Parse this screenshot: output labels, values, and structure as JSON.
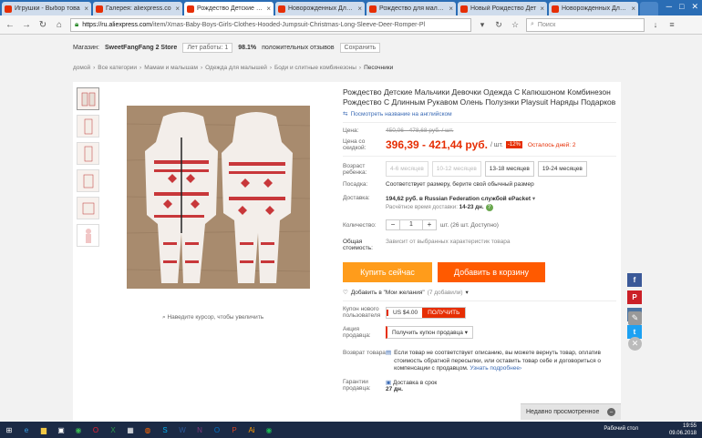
{
  "browser": {
    "tabs": [
      {
        "label": "Игрушки - Выбор това",
        "favicon_color": "#e62e04",
        "active": false
      },
      {
        "label": "Галерея: aliexpress.co",
        "favicon_color": "#e62e04",
        "active": false
      },
      {
        "label": "Рождество Детские Ма",
        "favicon_color": "#e62e04",
        "active": true
      },
      {
        "label": "Новорожденных Для м",
        "favicon_color": "#e62e04",
        "active": false
      },
      {
        "label": "Рождество для мальчи",
        "favicon_color": "#e62e04",
        "active": false
      },
      {
        "label": "Новый Рождество Дет",
        "favicon_color": "#e62e04",
        "active": false
      },
      {
        "label": "Новорожденных Для м",
        "favicon_color": "#e62e04",
        "active": false
      }
    ],
    "url_host": "https://ru.aliexpress.com",
    "url_path": "/item/Xmas-Baby-Boys-Girls-Clothes-Hooded-Jumpsuit-Christmas-Long-Sleeve-Deer-Romper-Pl",
    "search_placeholder": "Поиск"
  },
  "store": {
    "label": "Магазин:",
    "name": "SweetFangFang 2 Store",
    "years": "Лет работы: 1",
    "rating_pct": "98.1%",
    "rating_text": "положительных отзывов",
    "save": "Сохранить"
  },
  "breadcrumbs": [
    "домой",
    "Все категории",
    "Мамам и малышам",
    "Одежда для малышей",
    "Боди и слитные комбинезоны",
    "Песочники"
  ],
  "product": {
    "title": "Рождество Детские Мальчики Девочки Одежда С Капюшоном Комбинезон Рождество С Длинным Рукавом Олень Полузнки Playsuit Наряды Подарков",
    "translate": "Посмотреть название на английском",
    "price_label": "Цена:",
    "price_old": "450,06 - 478,68 руб. / шт.",
    "discount_label": "Цена со скидкой:",
    "price_new": "396,39 - 421,44 руб.",
    "price_unit": "/ шт.",
    "discount_pct": "-12%",
    "days_left": "Осталось дней: 2",
    "age_label": "Возраст ребенка:",
    "sizes": [
      {
        "label": "4-6 месяцев",
        "available": false
      },
      {
        "label": "10-12 месяцев",
        "available": false
      },
      {
        "label": "13-18 месяцев",
        "available": true
      },
      {
        "label": "19-24 месяцев",
        "available": true
      }
    ],
    "fit_label": "Посадка:",
    "fit_value": "Соответствует размеру, берите свой обычный размер",
    "ship_label": "Доставка:",
    "ship_value": "194,62 руб. в Russian Federation службой ePacket",
    "ship_time": "Расчётное время доставки:",
    "ship_days": "14-23 дн.",
    "qty_label": "Количество:",
    "qty_value": "1",
    "qty_stock": "шт. (26 шт. Доступно)",
    "total_label": "Общая стоимость:",
    "total_value": "Зависит от выбранных характеристик товара",
    "buy_now": "Купить сейчас",
    "add_cart": "Добавить в корзину",
    "wish": "Добавить в \"Мои желания\"",
    "wish_count": "(7 добавили)",
    "newuser_label": "Купон нового пользователя",
    "coupon_amount": "US $4.00",
    "coupon_get": "ПОЛУЧИТЬ",
    "seller_label": "Акция продавца:",
    "seller_coupon": "Получить купон продавца",
    "return_label": "Возврат товара",
    "return_text": "Если товар не соответствует описанию, вы можете вернуть товар, оплатив стоимость обратной пересылки, или оставить товар себе и договориться о компенсации с продавцом.",
    "return_more": "Узнать подробнее",
    "guar_label": "Гарантии продавца:",
    "guar_value": "Доставка в срок",
    "guar_days": "27 дн.",
    "zoom_hint": "Наведите курсор, чтобы увеличить"
  },
  "social": [
    {
      "name": "facebook-icon",
      "glyph": "f",
      "color": "#3b5998"
    },
    {
      "name": "pinterest-icon",
      "glyph": "P",
      "color": "#cb2027"
    },
    {
      "name": "vk-icon",
      "glyph": "vk",
      "color": "#4c75a3"
    },
    {
      "name": "twitter-icon",
      "glyph": "t",
      "color": "#1da1f2"
    }
  ],
  "recent_label": "Недавно просмотренное",
  "taskbar": {
    "desktop": "Рабочий стол",
    "time": "19:55",
    "date": "09.06.2018"
  }
}
